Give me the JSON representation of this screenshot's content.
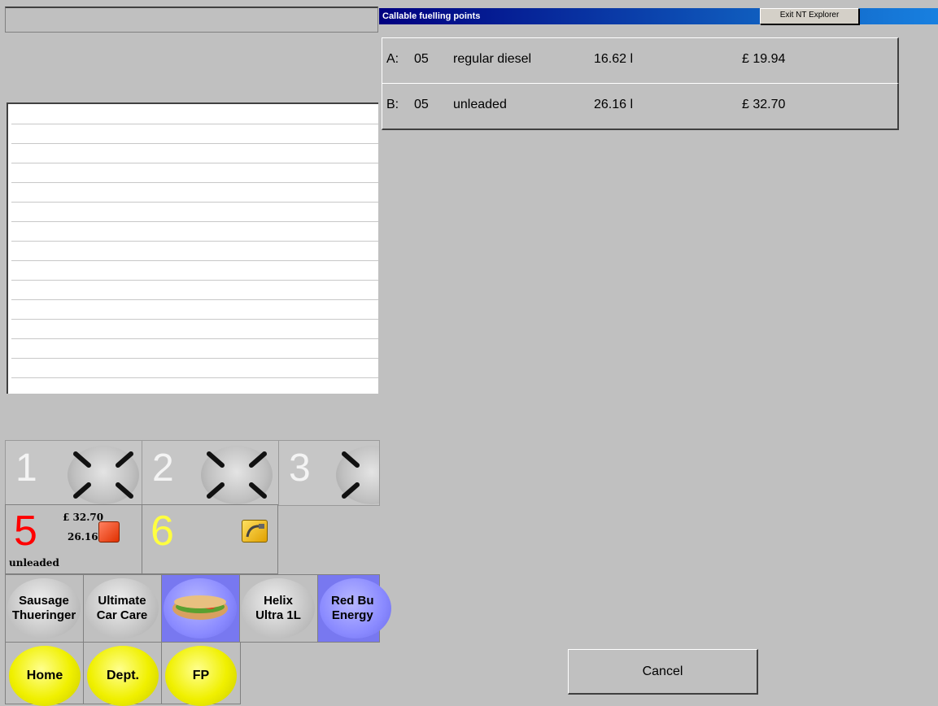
{
  "window": {
    "title": "Callable fuelling points",
    "exit_label": "Exit NT Explorer",
    "titlebar_color": "#000080"
  },
  "fuelling_rows": [
    {
      "letter": "A:",
      "pump": "05",
      "product": "regular diesel",
      "volume": "16.62 l",
      "amount": "£ 19.94"
    },
    {
      "letter": "B:",
      "pump": "05",
      "product": "unleaded",
      "volume": "26.16 l",
      "amount": "£ 32.70"
    }
  ],
  "cancel_label": "Cancel",
  "fuel_points_top": [
    {
      "number": "1",
      "icon": "nozzle-x-icon"
    },
    {
      "number": "2",
      "icon": "nozzle-x-icon"
    },
    {
      "number": "3",
      "icon": "nozzle-x-icon"
    }
  ],
  "pumps": {
    "p5": {
      "number": "5",
      "amount": "£ 32.70",
      "volume": "26.16 l",
      "product": "unleaded",
      "color": "#ff0000",
      "status_icon": "stop-square-icon"
    },
    "p6": {
      "number": "6",
      "color": "#ffff40",
      "status_icon": "fuel-nozzle-icon"
    }
  },
  "products": [
    {
      "label": "Sausage\nThueringer"
    },
    {
      "label": "Ultimate\nCar Care"
    },
    {
      "label": "",
      "icon": "sandwich-icon"
    },
    {
      "label": "Helix\nUltra 1L"
    },
    {
      "label": "Red Bu\nEnergy",
      "icon": "drink-icon"
    }
  ],
  "nav": {
    "home": "Home",
    "dept": "Dept.",
    "fp": "FP"
  }
}
